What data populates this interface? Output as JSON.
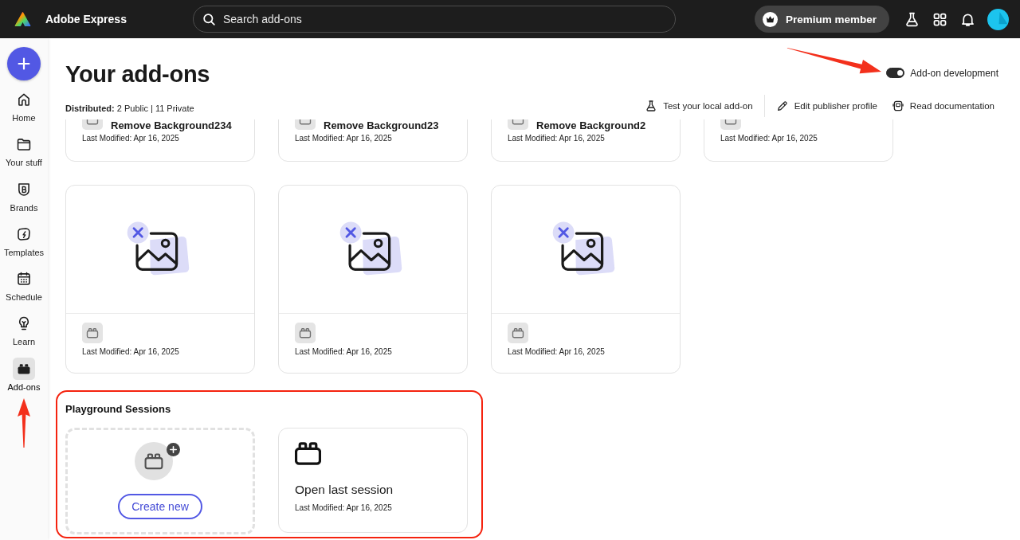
{
  "app": {
    "name": "Adobe Express"
  },
  "search": {
    "placeholder": "Search add-ons"
  },
  "account": {
    "plan": "Premium member"
  },
  "sidebar": {
    "items": [
      {
        "label": "Home",
        "selected": false,
        "callout_arrow": false
      },
      {
        "label": "Your stuff",
        "selected": false,
        "callout_arrow": false
      },
      {
        "label": "Brands",
        "selected": false,
        "callout_arrow": false
      },
      {
        "label": "Templates",
        "selected": false,
        "callout_arrow": false
      },
      {
        "label": "Schedule",
        "selected": false,
        "callout_arrow": false
      },
      {
        "label": "Learn",
        "selected": false,
        "callout_arrow": false
      },
      {
        "label": "Add-ons",
        "selected": true,
        "callout_arrow": true
      }
    ]
  },
  "page": {
    "title": "Your add-ons",
    "distributed": "**Distributed:** 2 Public | 11 Private"
  },
  "dev_toggle": {
    "label": "Add-on development",
    "on": true,
    "callout_arrow": true
  },
  "actions": [
    {
      "label": "Test your local add-on"
    },
    {
      "label": "Edit publisher profile"
    },
    {
      "label": "Read documentation"
    }
  ],
  "addons": [
    {
      "title": "Remove Background234",
      "modified": "Last Modified: Apr 16, 2025"
    },
    {
      "title": "Remove Background23",
      "modified": "Last Modified: Apr 16, 2025"
    },
    {
      "title": "Remove Background2",
      "modified": "Last Modified: Apr 16, 2025"
    },
    {
      "modified": "Last Modified: Apr 16, 2025"
    },
    {
      "modified": "Last Modified: Apr 16, 2025"
    },
    {
      "modified": "Last Modified: Apr 16, 2025"
    },
    {
      "modified": "Last Modified: Apr 16, 2025"
    }
  ],
  "playground": {
    "title": "Playground Sessions",
    "highlighted": true,
    "create_button": "Create new",
    "last_session": {
      "title": "Open last session",
      "modified": "Last Modified: Apr 16, 2025"
    }
  }
}
